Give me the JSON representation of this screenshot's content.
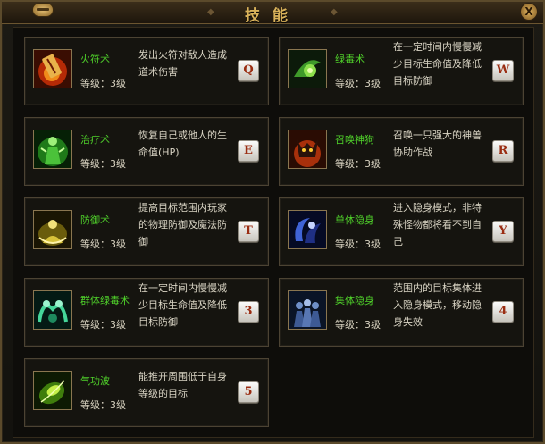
{
  "window": {
    "title": "技能",
    "close_label": "X"
  },
  "skills": [
    {
      "name": "火符术",
      "level": "等级：3级",
      "desc": "发出火符对敌人造成道术伤害",
      "key": "Q",
      "icon": "fire-talisman-icon"
    },
    {
      "name": "绿毒术",
      "level": "等级：3级",
      "desc": "在一定时间内慢慢减少目标生命值及降低目标防御",
      "key": "W",
      "icon": "poison-icon"
    },
    {
      "name": "治疗术",
      "level": "等级：3级",
      "desc": "恢复自己或他人的生命值(HP)",
      "key": "E",
      "icon": "healing-icon"
    },
    {
      "name": "召唤神狗",
      "level": "等级：3级",
      "desc": "召唤一只强大的神兽协助作战",
      "key": "R",
      "icon": "summon-beast-icon"
    },
    {
      "name": "防御术",
      "level": "等级：3级",
      "desc": "提高目标范围内玩家的物理防御及魔法防御",
      "key": "T",
      "icon": "defense-icon"
    },
    {
      "name": "单体隐身",
      "level": "等级：3级",
      "desc": "进入隐身模式，非特殊怪物都将看不到自己",
      "key": "Y",
      "icon": "stealth-icon"
    },
    {
      "name": "群体绿毒术",
      "level": "等级：3级",
      "desc": "在一定时间内慢慢减少目标生命值及降低目标防御",
      "key": "3",
      "icon": "mass-poison-icon"
    },
    {
      "name": "集体隐身",
      "level": "等级：3级",
      "desc": "范围内的目标集体进入隐身模式，移动隐身失效",
      "key": "4",
      "icon": "mass-stealth-icon"
    },
    {
      "name": "气功波",
      "level": "等级：3级",
      "desc": "能推开周围低于自身等级的目标",
      "key": "5",
      "icon": "qigong-wave-icon"
    }
  ]
}
